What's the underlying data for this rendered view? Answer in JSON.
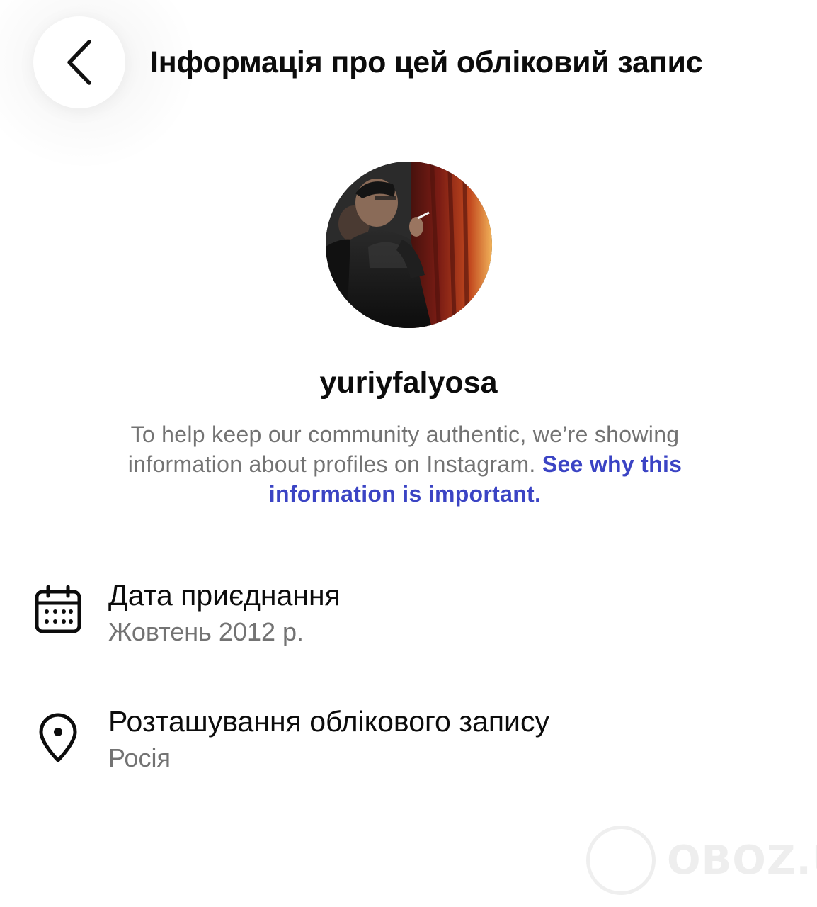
{
  "header": {
    "back_icon": "chevron-left-icon",
    "title": "Інформація про цей обліковий запис"
  },
  "profile": {
    "avatar_icon": "profile-photo",
    "username": "yuriyfalyosa",
    "description_text": "To help keep our community authentic, we’re showing information about profiles on Instagram.",
    "description_link": "See why this information is important."
  },
  "details": [
    {
      "icon": "calendar-icon",
      "label": "Дата приєднання",
      "value": "Жовтень 2012 р."
    },
    {
      "icon": "location-pin-icon",
      "label": "Розташування облікового запису",
      "value": "Росія"
    }
  ],
  "watermark": {
    "text": "OBOZ.UA"
  },
  "colors": {
    "link": "#3b44c4",
    "secondary_text": "#737373",
    "primary_text": "#0c0c0c"
  }
}
